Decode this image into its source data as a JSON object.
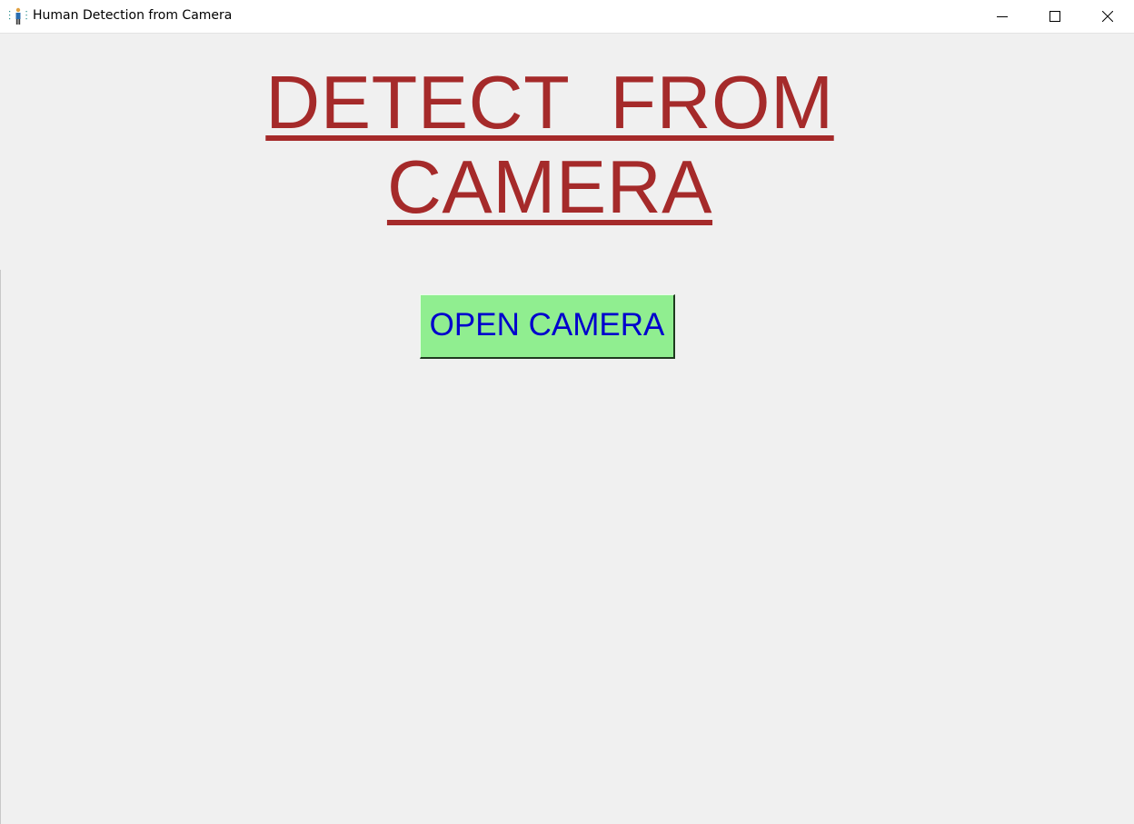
{
  "window": {
    "title": "Human Detection from Camera",
    "icon": "person-standing-icon",
    "controls": [
      "minimize-icon",
      "maximize-icon",
      "close-icon"
    ]
  },
  "main": {
    "heading": "DETECT  FROM CAMERA",
    "open_camera_label": "OPEN CAMERA"
  },
  "colors": {
    "background": "#f0f0f0",
    "heading": "#a52a2a",
    "button_bg": "#90ee90",
    "button_text": "#0000cd"
  }
}
